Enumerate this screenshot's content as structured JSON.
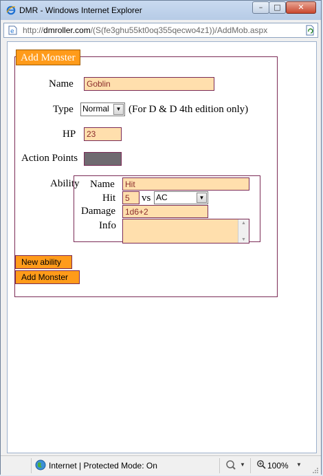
{
  "window": {
    "title": "DMR - Windows Internet Explorer",
    "minimize_glyph": "–",
    "maximize_glyph": "□",
    "close_glyph": "✕"
  },
  "address": {
    "prefix": "http://",
    "host": "dmroller.com",
    "path": "/(S(fe3ghu55kt0oq355qecwo4z1))/AddMob.aspx"
  },
  "form": {
    "title": "Add Monster",
    "name_label": "Name",
    "name_value": "Goblin",
    "type_label": "Type",
    "type_value": "Normal",
    "type_note": "(For D & D 4th edition only)",
    "hp_label": "HP",
    "hp_value": "23",
    "action_points_label": "Action Points",
    "ability_label": "Ability",
    "ability": {
      "name_label": "Name",
      "name_value": "Hit",
      "hit_label": "Hit",
      "hit_value": "5",
      "vs_label": "vs",
      "vs_value": "AC",
      "damage_label": "Damage",
      "damage_value": "1d6+2",
      "info_label": "Info"
    },
    "new_ability_button": "New ability",
    "add_monster_button": "Add Monster"
  },
  "statusbar": {
    "zone": "Internet | Protected Mode: On",
    "zoom": "100%"
  },
  "icons": {
    "window": "internet-explorer-icon",
    "page": "page-icon",
    "refresh": "refresh-icon",
    "zone": "globe-icon",
    "security": "security-icon",
    "zoom": "zoom-icon"
  },
  "colors": {
    "accent_orange": "#ff9b1a",
    "field_fill": "#ffdfad",
    "border": "#7a2a55"
  }
}
